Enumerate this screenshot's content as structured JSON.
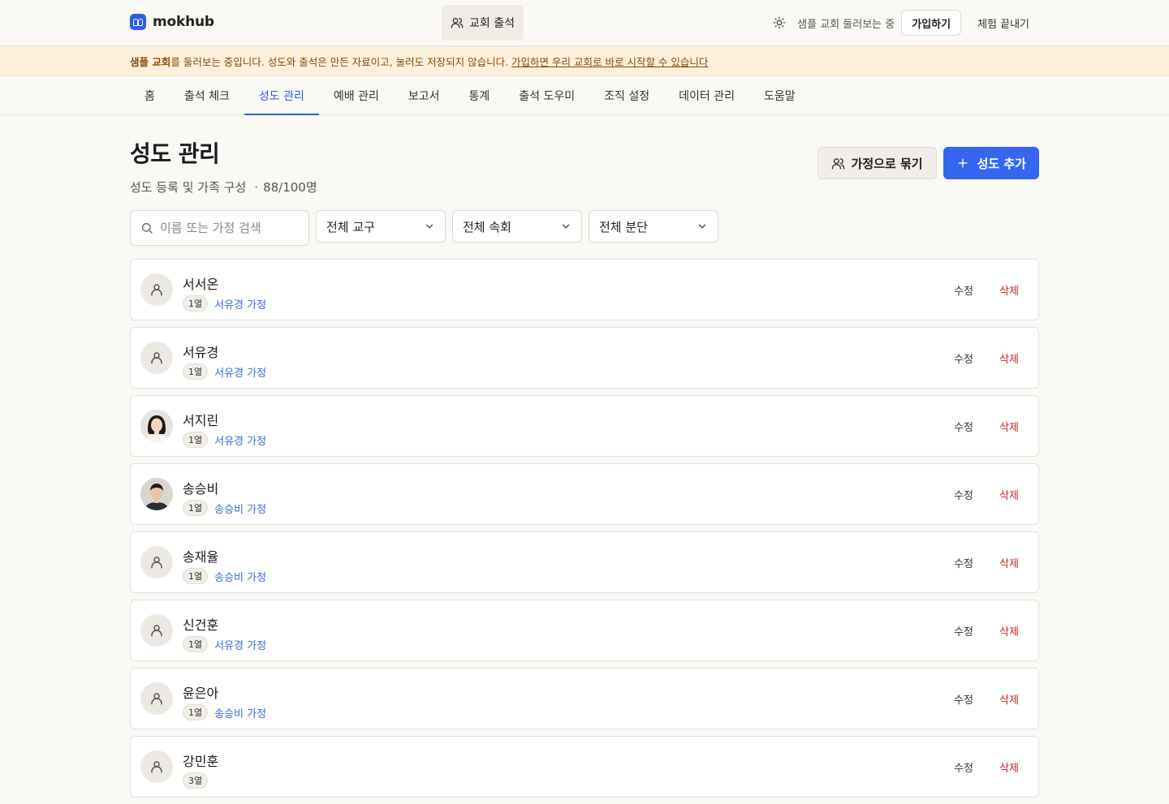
{
  "brand": {
    "name": "mokhub"
  },
  "topbar": {
    "center_label": "교회 출석",
    "sample_text": "샘플 교회 둘러보는 중",
    "signup_label": "가입하기",
    "end_label": "체험 끝내기"
  },
  "banner": {
    "strong": "샘플 교회",
    "text": "를 둘러보는 중입니다. 성도와 출석은 만든 자료이고, 눌러도 저장되지 않습니다.",
    "link": "가입하면 우리 교회로 바로 시작할 수 있습니다"
  },
  "nav": {
    "items": [
      {
        "label": "홈"
      },
      {
        "label": "출석 체크"
      },
      {
        "label": "성도 관리"
      },
      {
        "label": "예배 관리"
      },
      {
        "label": "보고서"
      },
      {
        "label": "통계"
      },
      {
        "label": "출석 도우미"
      },
      {
        "label": "조직 설정"
      },
      {
        "label": "데이터 관리"
      },
      {
        "label": "도움말"
      }
    ],
    "active_index": 2
  },
  "page": {
    "title": "성도 관리",
    "subtitle": "성도 등록 및 가족 구성",
    "count": "88/100명",
    "family_btn": "가정으로 묶기",
    "add_btn": "성도 추가"
  },
  "filters": {
    "search_placeholder": "이름 또는 가정 검색",
    "district": "전체 교구",
    "cell": "전체 속회",
    "division": "전체 분단"
  },
  "members": [
    {
      "name": "서서온",
      "badge": "1열",
      "family": "서유경 가정",
      "photo": false
    },
    {
      "name": "서유경",
      "badge": "1열",
      "family": "서유경 가정",
      "photo": false
    },
    {
      "name": "서지린",
      "badge": "1열",
      "family": "서유경 가정",
      "photo": "female"
    },
    {
      "name": "송승비",
      "badge": "1열",
      "family": "송승비 가정",
      "photo": "male"
    },
    {
      "name": "송재율",
      "badge": "1열",
      "family": "송승비 가정",
      "photo": false
    },
    {
      "name": "신건훈",
      "badge": "1열",
      "family": "서유경 가정",
      "photo": false
    },
    {
      "name": "윤은아",
      "badge": "1열",
      "family": "송승비 가정",
      "photo": false
    },
    {
      "name": "강민훈",
      "badge": "3열",
      "family": "",
      "photo": false
    }
  ],
  "row_actions": {
    "edit": "수정",
    "delete": "삭제"
  },
  "colors": {
    "accent": "#2f5de8",
    "danger": "#c4252a",
    "banner_bg": "#fdf0dc"
  }
}
